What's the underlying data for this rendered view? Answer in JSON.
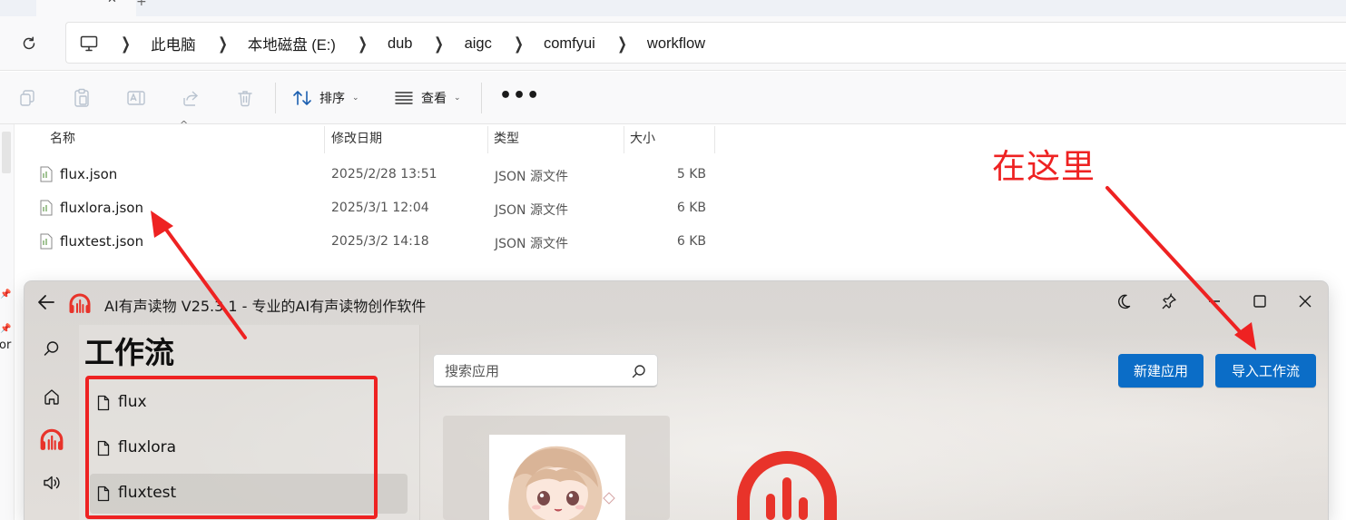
{
  "explorer": {
    "breadcrumb": [
      "此电脑",
      "本地磁盘 (E:)",
      "dub",
      "aigc",
      "comfyui",
      "workflow"
    ],
    "toolbar": {
      "sort_label": "排序",
      "view_label": "查看",
      "more_label": "•••"
    },
    "columns": {
      "name": "名称",
      "modified": "修改日期",
      "type": "类型",
      "size": "大小"
    },
    "files": [
      {
        "name": "flux.json",
        "modified": "2025/2/28 13:51",
        "type": "JSON 源文件",
        "size": "5 KB"
      },
      {
        "name": "fluxlora.json",
        "modified": "2025/3/1 12:04",
        "type": "JSON 源文件",
        "size": "6 KB"
      },
      {
        "name": "fluxtest.json",
        "modified": "2025/3/2 14:18",
        "type": "JSON 源文件",
        "size": "6 KB"
      }
    ],
    "nav_fragment": "or"
  },
  "annotation": {
    "label": "在这里",
    "color": "#ee2222"
  },
  "app": {
    "title": "AI有声读物 V25.3.1 - 专业的AI有声读物创作软件",
    "section_title": "工作流",
    "workflows": [
      {
        "label": "flux",
        "selected": false
      },
      {
        "label": "fluxlora",
        "selected": false
      },
      {
        "label": "fluxtest",
        "selected": true
      }
    ],
    "search": {
      "placeholder": "搜索应用"
    },
    "buttons": {
      "new_app": "新建应用",
      "import_workflow": "导入工作流"
    },
    "colors": {
      "accent": "#0b6dc7",
      "logo_red": "#e8332a"
    },
    "icons": {
      "back": "arrow-left-icon",
      "theme": "moon-icon",
      "pin": "pin-icon",
      "minimize": "minimize-icon",
      "maximize": "maximize-icon",
      "close": "close-icon",
      "search": "search-icon",
      "home": "home-icon",
      "audiobook": "headphones-logo-icon",
      "speaker": "speaker-icon"
    }
  }
}
